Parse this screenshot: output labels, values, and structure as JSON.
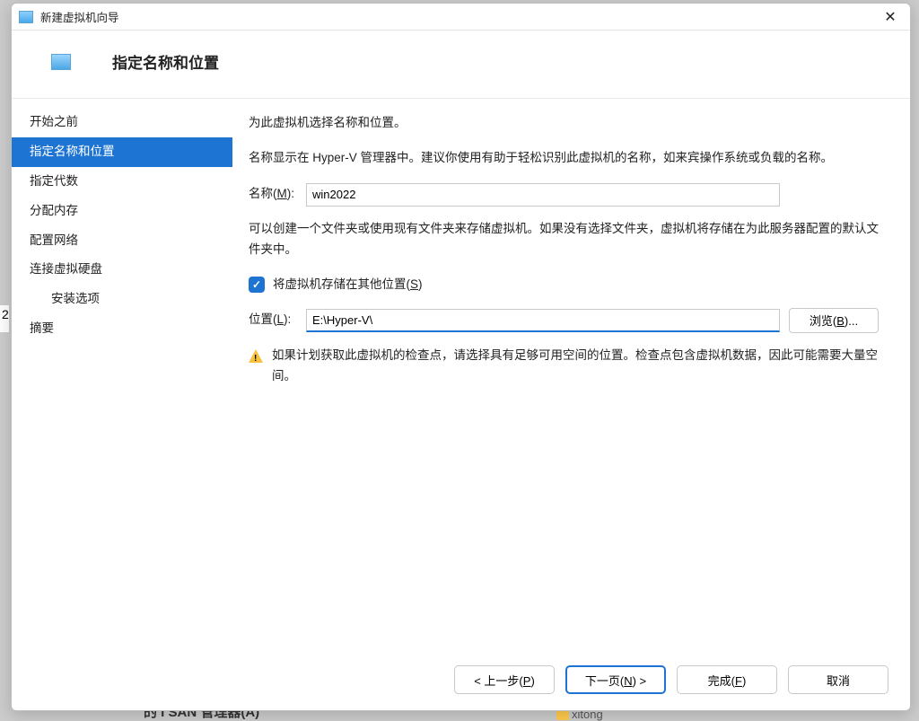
{
  "window": {
    "title": "新建虚拟机向导"
  },
  "header": {
    "title": "指定名称和位置"
  },
  "sidebar": {
    "items": [
      {
        "label": "开始之前"
      },
      {
        "label": "指定名称和位置"
      },
      {
        "label": "指定代数"
      },
      {
        "label": "分配内存"
      },
      {
        "label": "配置网络"
      },
      {
        "label": "连接虚拟硬盘"
      },
      {
        "label": "安装选项"
      },
      {
        "label": "摘要"
      }
    ]
  },
  "main": {
    "intro": "为此虚拟机选择名称和位置。",
    "desc1": "名称显示在 Hyper-V 管理器中。建议你使用有助于轻松识别此虚拟机的名称，如来宾操作系统或负载的名称。",
    "name_label_prefix": "名称(",
    "name_label_key": "M",
    "name_label_suffix": "):",
    "name_value": "win2022",
    "desc2": "可以创建一个文件夹或使用现有文件夹来存储虚拟机。如果没有选择文件夹，虚拟机将存储在为此服务器配置的默认文件夹中。",
    "store_chk_prefix": "将虚拟机存储在其他位置(",
    "store_chk_key": "S",
    "store_chk_suffix": ")",
    "loc_label_prefix": "位置(",
    "loc_label_key": "L",
    "loc_label_suffix": "):",
    "loc_value": "E:\\Hyper-V\\",
    "browse_prefix": "浏览(",
    "browse_key": "B",
    "browse_suffix": ")...",
    "warning": "如果计划获取此虚拟机的检查点，请选择具有足够可用空间的位置。检查点包含虚拟机数据，因此可能需要大量空间。"
  },
  "footer": {
    "prev_prefix": "< 上一步(",
    "prev_key": "P",
    "prev_suffix": ")",
    "next_prefix": "下一页(",
    "next_key": "N",
    "next_suffix": ") >",
    "finish_prefix": "完成(",
    "finish_key": "F",
    "finish_suffix": ")",
    "cancel": "取消"
  },
  "backdrop": {
    "left_num": "2",
    "bottom_text": "的 I SAN 管理器(A)",
    "bottom_text2": "xitong"
  }
}
